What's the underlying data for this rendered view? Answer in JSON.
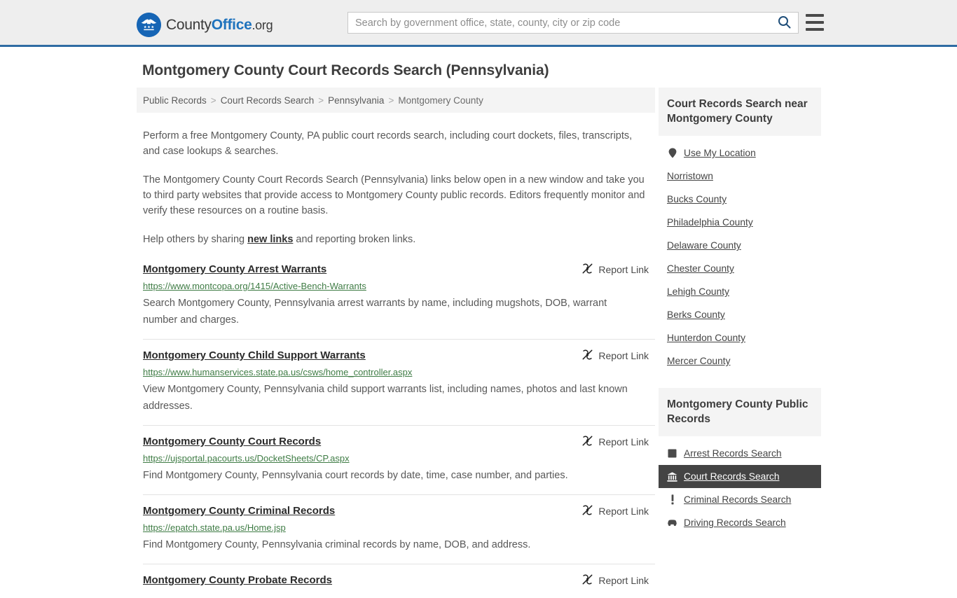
{
  "header": {
    "brand": {
      "part1": "County",
      "part2": "Office",
      "part3": ".org",
      "logo_icon": "eagle-shield-logo"
    },
    "search": {
      "placeholder": "Search by government office, state, county, city or zip code",
      "value": "",
      "search_icon": "search-icon"
    },
    "menu_icon": "hamburger-menu-icon",
    "accent_color": "#2f6ca3",
    "background_color": "#eeeeee"
  },
  "page": {
    "title": "Montgomery County Court Records Search (Pennsylvania)"
  },
  "breadcrumb": {
    "items": [
      {
        "label": "Public Records",
        "current": false
      },
      {
        "label": "Court Records Search",
        "current": false
      },
      {
        "label": "Pennsylvania",
        "current": false
      },
      {
        "label": "Montgomery County",
        "current": true
      }
    ],
    "separator": ">"
  },
  "intro": {
    "paragraph1": "Perform a free Montgomery County, PA public court records search, including court dockets, files, transcripts, and case lookups & searches.",
    "paragraph2": "The Montgomery County Court Records Search (Pennsylvania) links below open in a new window and take you to third party websites that provide access to Montgomery County public records. Editors frequently monitor and verify these resources on a routine basis.",
    "paragraph3_before": "Help others by sharing ",
    "paragraph3_link": "new links",
    "paragraph3_after": " and reporting broken links."
  },
  "results": {
    "report_link_label": "Report Link",
    "report_link_icon": "broken-link-icon",
    "items": [
      {
        "title": "Montgomery County Arrest Warrants",
        "url": "https://www.montcopa.org/1415/Active-Bench-Warrants",
        "description": "Search Montgomery County, Pennsylvania arrest warrants by name, including mugshots, DOB, warrant number and charges."
      },
      {
        "title": "Montgomery County Child Support Warrants",
        "url": "https://www.humanservices.state.pa.us/csws/home_controller.aspx",
        "description": "View Montgomery County, Pennsylvania child support warrants list, including names, photos and last known addresses."
      },
      {
        "title": "Montgomery County Court Records",
        "url": "https://ujsportal.pacourts.us/DocketSheets/CP.aspx",
        "description": "Find Montgomery County, Pennsylvania court records by date, time, case number, and parties."
      },
      {
        "title": "Montgomery County Criminal Records",
        "url": "https://epatch.state.pa.us/Home.jsp",
        "description": "Find Montgomery County, Pennsylvania criminal records by name, DOB, and address."
      },
      {
        "title": "Montgomery County Probate Records",
        "url": "",
        "description": ""
      }
    ]
  },
  "sidebar": {
    "nearby": {
      "heading": "Court Records Search near Montgomery County",
      "items": [
        {
          "label": "Use My Location",
          "icon": "map-pin-icon"
        },
        {
          "label": "Norristown",
          "icon": ""
        },
        {
          "label": "Bucks County",
          "icon": ""
        },
        {
          "label": "Philadelphia County",
          "icon": ""
        },
        {
          "label": "Delaware County",
          "icon": ""
        },
        {
          "label": "Chester County",
          "icon": ""
        },
        {
          "label": "Lehigh County",
          "icon": ""
        },
        {
          "label": "Berks County",
          "icon": ""
        },
        {
          "label": "Hunterdon County",
          "icon": ""
        },
        {
          "label": "Mercer County",
          "icon": ""
        }
      ]
    },
    "public_records": {
      "heading": "Montgomery County Public Records",
      "items": [
        {
          "label": "Arrest Records Search",
          "icon": "square-icon",
          "active": false
        },
        {
          "label": "Court Records Search",
          "icon": "courthouse-icon",
          "active": true
        },
        {
          "label": "Criminal Records Search",
          "icon": "exclamation-icon",
          "active": false
        },
        {
          "label": "Driving Records Search",
          "icon": "car-icon",
          "active": false
        }
      ],
      "active_background_color": "#444444"
    }
  }
}
